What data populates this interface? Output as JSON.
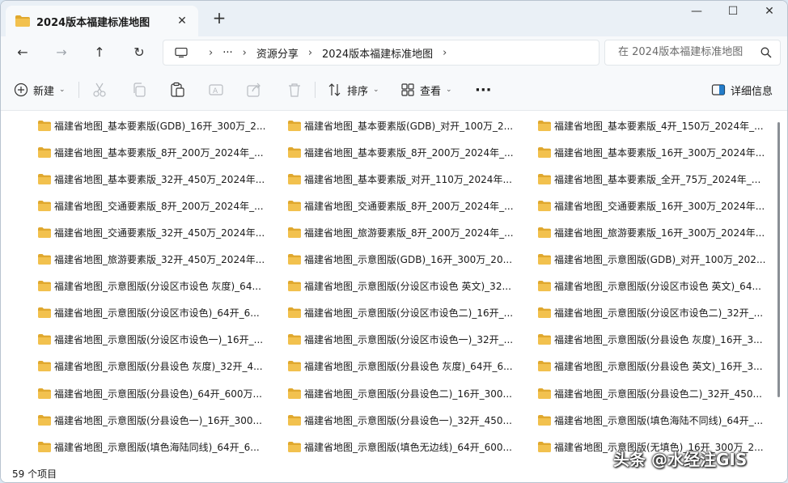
{
  "window": {
    "tab_title": "2024版本福建标准地图",
    "new_tab": "+",
    "controls": {
      "minimize": "—",
      "maximize": "☐",
      "close": "✕"
    },
    "tab_close": "✕"
  },
  "nav": {
    "back": "←",
    "forward": "→",
    "up": "↑",
    "refresh": "↻"
  },
  "address": {
    "ellipsis": "···",
    "crumbs": [
      "资源分享",
      "2024版本福建标准地图"
    ],
    "sep": "›"
  },
  "search": {
    "placeholder": "在 2024版本福建标准地图"
  },
  "toolbar": {
    "new_label": "新建",
    "sort_label": "排序",
    "view_label": "查看",
    "more_label": "···",
    "details_label": "详细信息",
    "chevron": "⌄"
  },
  "files": [
    "福建省地图_基本要素版(GDB)_16开_300万_2...",
    "福建省地图_基本要素版(GDB)_对开_100万_2...",
    "福建省地图_基本要素版_4开_150万_2024年_...",
    "福建省地图_基本要素版_8开_200万_2024年_...",
    "福建省地图_基本要素版_8开_200万_2024年_...",
    "福建省地图_基本要素版_16开_300万_2024年...",
    "福建省地图_基本要素版_32开_450万_2024年...",
    "福建省地图_基本要素版_对开_110万_2024年...",
    "福建省地图_基本要素版_全开_75万_2024年_...",
    "福建省地图_交通要素版_8开_200万_2024年_...",
    "福建省地图_交通要素版_8开_200万_2024年_...",
    "福建省地图_交通要素版_16开_300万_2024年...",
    "福建省地图_交通要素版_32开_450万_2024年...",
    "福建省地图_旅游要素版_8开_200万_2024年_...",
    "福建省地图_旅游要素版_16开_300万_2024年...",
    "福建省地图_旅游要素版_32开_450万_2024年...",
    "福建省地图_示意图版(GDB)_16开_300万_20...",
    "福建省地图_示意图版(GDB)_对开_100万_202...",
    "福建省地图_示意图版(分设区市设色 灰度)_64...",
    "福建省地图_示意图版(分设区市设色 英文)_32...",
    "福建省地图_示意图版(分设区市设色 英文)_64...",
    "福建省地图_示意图版(分设区市设色)_64开_6...",
    "福建省地图_示意图版(分设区市设色二)_16开_...",
    "福建省地图_示意图版(分设区市设色二)_32开_...",
    "福建省地图_示意图版(分设区市设色一)_16开_...",
    "福建省地图_示意图版(分设区市设色一)_32开_...",
    "福建省地图_示意图版(分县设色 灰度)_16开_3...",
    "福建省地图_示意图版(分县设色 灰度)_32开_4...",
    "福建省地图_示意图版(分县设色 灰度)_64开_6...",
    "福建省地图_示意图版(分县设色 英文)_16开_3...",
    "福建省地图_示意图版(分县设色)_64开_600万...",
    "福建省地图_示意图版(分县设色二)_16开_300...",
    "福建省地图_示意图版(分县设色二)_32开_450...",
    "福建省地图_示意图版(分县设色一)_16开_300...",
    "福建省地图_示意图版(分县设色一)_32开_450...",
    "福建省地图_示意图版(填色海陆不同线)_64开_...",
    "福建省地图_示意图版(填色海陆同线)_64开_6...",
    "福建省地图_示意图版(填色无边线)_64开_600...",
    "福建省地图_示意图版(无填色)_16开_300万_2..."
  ],
  "status": {
    "count": "59 个项目"
  },
  "watermark": "头条 @水经注GIS",
  "colors": {
    "folder": "#f2c14e",
    "folder_dark": "#e0a82e",
    "accent": "#0067c0"
  }
}
